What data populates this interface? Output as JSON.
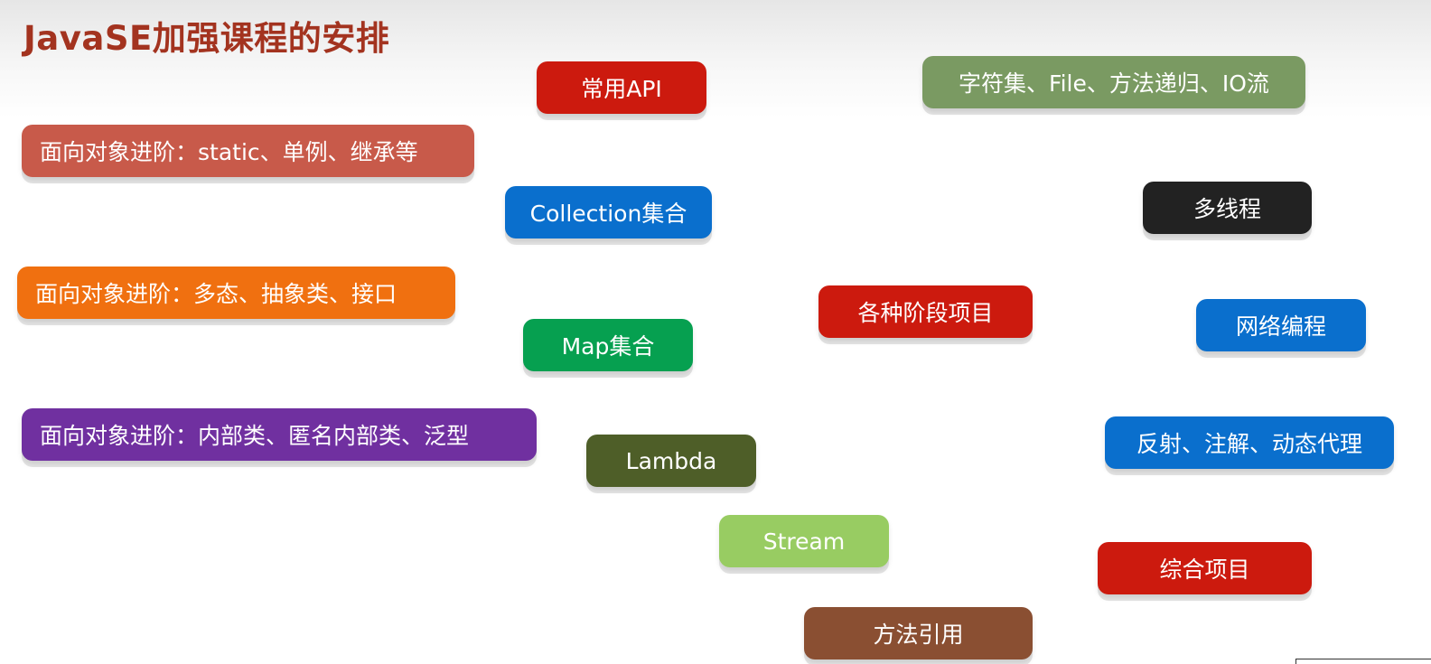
{
  "title": "JavaSE加强课程的安排",
  "topics": {
    "oop1": "面向对象进阶：static、单例、继承等",
    "oop2": "面向对象进阶：多态、抽象类、接口",
    "oop3": "面向对象进阶：内部类、匿名内部类、泛型",
    "api": "常用API",
    "collection": "Collection集合",
    "map": "Map集合",
    "lambda": "Lambda",
    "stream": "Stream",
    "method_ref": "方法引用",
    "stage_projects": "各种阶段项目",
    "io": "字符集、File、方法递归、IO流",
    "thread": "多线程",
    "network": "网络编程",
    "reflection": "反射、注解、动态代理",
    "final_project": "综合项目"
  },
  "colors": {
    "title": "#a3331f",
    "oop1": "#c85a4a",
    "oop2": "#f07010",
    "oop3": "#7030a0",
    "api": "#cc1a0e",
    "collection": "#0a6fcd",
    "map": "#06a050",
    "lambda": "#4e5e28",
    "stream": "#98cc62",
    "method_ref": "#8a4f32",
    "stage_projects": "#cc1a0e",
    "io": "#7a9a62",
    "thread": "#222222",
    "network": "#0a6fcd",
    "reflection": "#0a6fcd",
    "final_project": "#cc1a0e"
  }
}
